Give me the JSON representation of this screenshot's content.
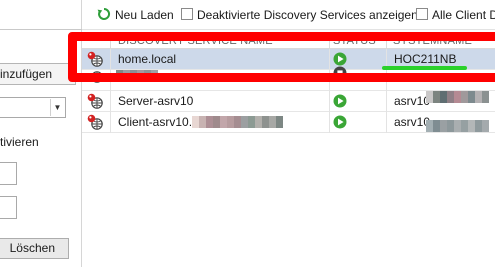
{
  "left_panel": {
    "add_button_label": "inzufügen",
    "activate_label": "tivieren",
    "delete_button_label": "Löschen"
  },
  "toolbar": {
    "reload_label": "Neu Laden",
    "show_disabled_label": "Deaktivierte Discovery Services anzeigen",
    "all_clients_label": "Alle Client D"
  },
  "grid": {
    "columns": [
      "DISCOVERY SERVICE NAME",
      "STATUS",
      "SYSTEMNAME"
    ],
    "rows": [
      {
        "name": "home.local",
        "status": "running",
        "system": "HOC211NB",
        "selected": true
      },
      {
        "name": "",
        "status": "stopped",
        "system": "",
        "selected": false
      },
      {
        "name": "Server-asrv10",
        "status": "running",
        "system": "asrv10",
        "selected": false
      },
      {
        "name": "Client-asrv10.",
        "status": "running",
        "system": "asrv10",
        "selected": false
      }
    ]
  },
  "colors": {
    "selection": "#cdd9ea",
    "status_running": "#3aa636",
    "status_stopped": "#444444",
    "annotation_red": "#ff0000",
    "annotation_green": "#2bd12b"
  }
}
